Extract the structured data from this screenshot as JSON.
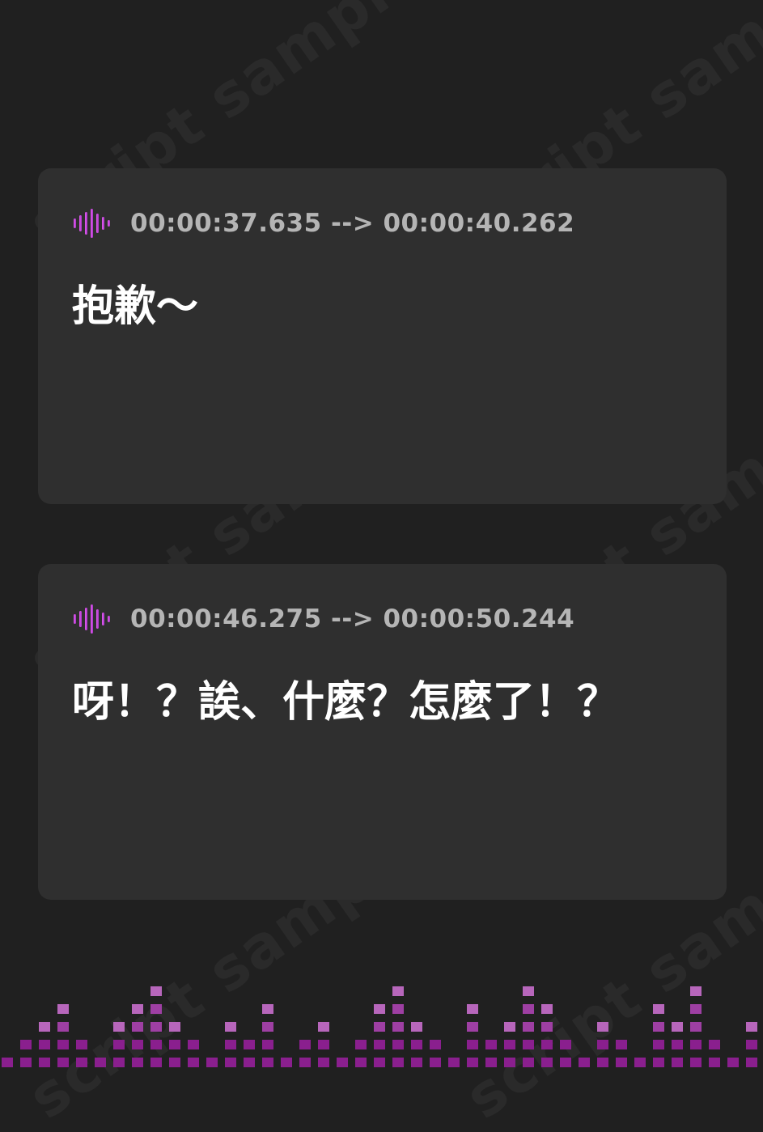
{
  "watermark": {
    "text": "script sample"
  },
  "cards": [
    {
      "timestamp": "00:00:37.635 --> 00:00:40.262",
      "text": "抱歉～"
    },
    {
      "timestamp": "00:00:46.275 --> 00:00:50.244",
      "text": "呀！？誒、什麼？怎麼了！？"
    }
  ],
  "colors": {
    "background": "#202020",
    "card": "#2f2f2f",
    "timestamp": "#b5b5b5",
    "text": "#ffffff",
    "accent_light": "#e45df0",
    "accent_dark": "#8a1f8e",
    "equalizer_mid": "#9e3fa3",
    "equalizer_top": "#b766bb"
  },
  "icons": {
    "card_icon": "audio-waveform-icon"
  }
}
